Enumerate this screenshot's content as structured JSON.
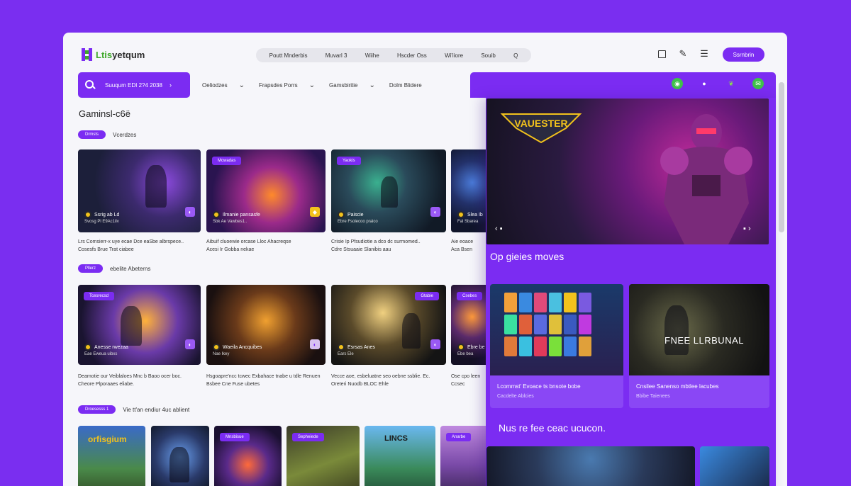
{
  "brand": {
    "name_prefix": "Ltis",
    "name_suffix": "yetqum"
  },
  "topnav": [
    "Poutt Mnderbis",
    "Muvarl 3",
    "Wiihe",
    "Hscder Oss",
    "Wi'iiore",
    "Souib",
    "Q"
  ],
  "top_icons": [
    "square-icon",
    "pen-icon",
    "menu-icon"
  ],
  "signin_label": "Ssrnbrin",
  "search": {
    "label": "Suuqum EDI 2?4 2038"
  },
  "filters": [
    "Oeliodzes",
    "Frapsdes Porrs",
    "Gamsbiritie",
    "Dolm Blidere"
  ],
  "section_title": "Gaminsl-c6ё",
  "row1_chip": {
    "chip": "Drmsts",
    "label": "Vcerdzes"
  },
  "row2_chip": {
    "chip": "Pllerz",
    "label": "ebelite Abeterns"
  },
  "row3_chip": {
    "chip": "Droesesss 1",
    "label": "Vie tt'an endiur 4uc ablient"
  },
  "row1_cards": [
    {
      "title": "Ssrig ab Ld",
      "sub": "Svosg Pl E9Ac1ilv",
      "desc": [
        "Lrs Comsierr-x uye ecae Dce eaSbe albrspece..",
        "Cosesfs Brue Trat ciabee"
      ]
    },
    {
      "badge": "Mcwadas",
      "title": "Ilmanie pansasfe",
      "sub": "Sbk Ae Vawbes1..",
      "desc": [
        "Aibuif cluoewie orcase Lloc Ahacreqse",
        "Acesi Ir Gobba nekae"
      ]
    },
    {
      "badge": "Yaokis",
      "title": "Paiscie",
      "sub": "Ebre Fsolecoo praico",
      "desc": [
        "Crisie Ip Pfsudiotie a dco dc surmomed..",
        "Cdre Stsuaaie Slanibis aau"
      ]
    },
    {
      "title": "Slea Ib",
      "sub": "Fal Sbarea",
      "desc": [
        "Aie eoace",
        "Aca Bsen"
      ]
    }
  ],
  "row2_cards": [
    {
      "badge": "Tcesrecsd",
      "title": "Anesse rwezaa",
      "sub": "Eae Eweua uibxs",
      "desc": [
        "Deamotie our Veiblaloes Mnc b Baoo ocer boc.",
        "Cheore Plporaaes eliabe."
      ]
    },
    {
      "title": "Waeila Ancquibes",
      "sub": "Nae lkey",
      "desc": [
        "Hsgoapre'ncc tcwec Exbahace tnabe u tdle Renuen",
        "Bsbee Cne Fuse ubetes"
      ]
    },
    {
      "badge": "Gtabie",
      "title": "Esrsas Anes",
      "sub": "Ears Ele",
      "desc": [
        "Vecce aoe, esbeluatne seo oebne ssblie. Ec.",
        "Oreteri Nuodb BLOC Ehle"
      ]
    },
    {
      "badge": "Csebes",
      "title": "Ebre be",
      "sub": "Ebe bea",
      "desc": [
        "Ose cpo leen",
        "Ccsec"
      ]
    }
  ],
  "row3_cards": [
    {
      "title": "orfisgium"
    },
    {
      "title": ""
    },
    {
      "badge": "Mnsbisue"
    },
    {
      "badge": "Sepheiede"
    },
    {
      "title": "LINCS"
    },
    {
      "badge": "Anarbe"
    }
  ],
  "panel": {
    "hero_title": "VAUESTER",
    "section1": "Op gieies moves",
    "card1": {
      "title": "Lcommst' Evoace ts bnsote bobe",
      "sub": "Cacdelte Ablcies"
    },
    "card2": {
      "image_text": "FNEE LLRBUNAL",
      "title": "Cnsilee Sanenso mbtlee lacubes",
      "sub": "Bbibe Taienees"
    },
    "section2": "Nus re fee ceac ucucon."
  }
}
